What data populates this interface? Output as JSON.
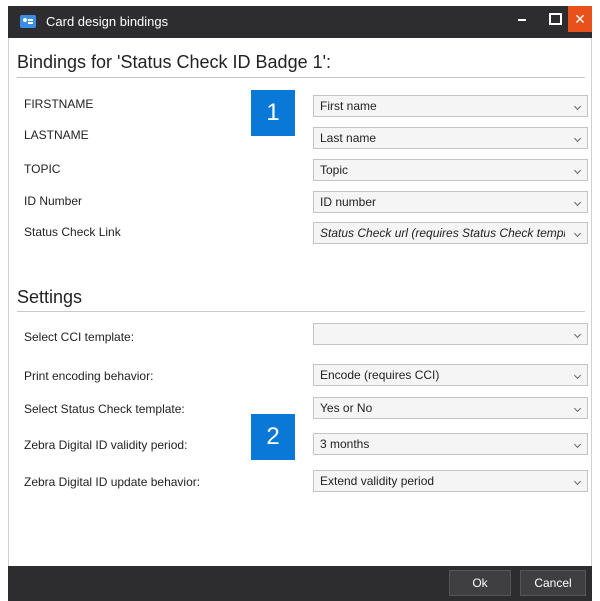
{
  "window": {
    "title": "Card design bindings",
    "close_glyph": "✕"
  },
  "bindings": {
    "heading": "Bindings for 'Status Check ID Badge 1':",
    "rows": [
      {
        "label": "FIRSTNAME",
        "value": "First name"
      },
      {
        "label": "LASTNAME",
        "value": "Last name"
      },
      {
        "label": "TOPIC",
        "value": "Topic"
      },
      {
        "label": "ID Number",
        "value": "ID number"
      },
      {
        "label": "Status Check Link",
        "value": "Status Check url (requires Status Check template)"
      }
    ]
  },
  "settings": {
    "heading": "Settings",
    "rows": [
      {
        "label": "Select CCI template:",
        "value": ""
      },
      {
        "label": "Print encoding behavior:",
        "value": "Encode (requires CCI)"
      },
      {
        "label": "Select Status Check template:",
        "value": "Yes or No"
      },
      {
        "label": "Zebra Digital ID validity period:",
        "value": "3 months"
      },
      {
        "label": "Zebra Digital ID update behavior:",
        "value": "Extend validity period"
      }
    ]
  },
  "callouts": [
    "1",
    "2"
  ],
  "footer": {
    "ok_label": "Ok",
    "cancel_label": "Cancel"
  },
  "colors": {
    "titlebar": "#2d2d30",
    "close_button": "#e8501c",
    "callout": "#0a78d7"
  }
}
